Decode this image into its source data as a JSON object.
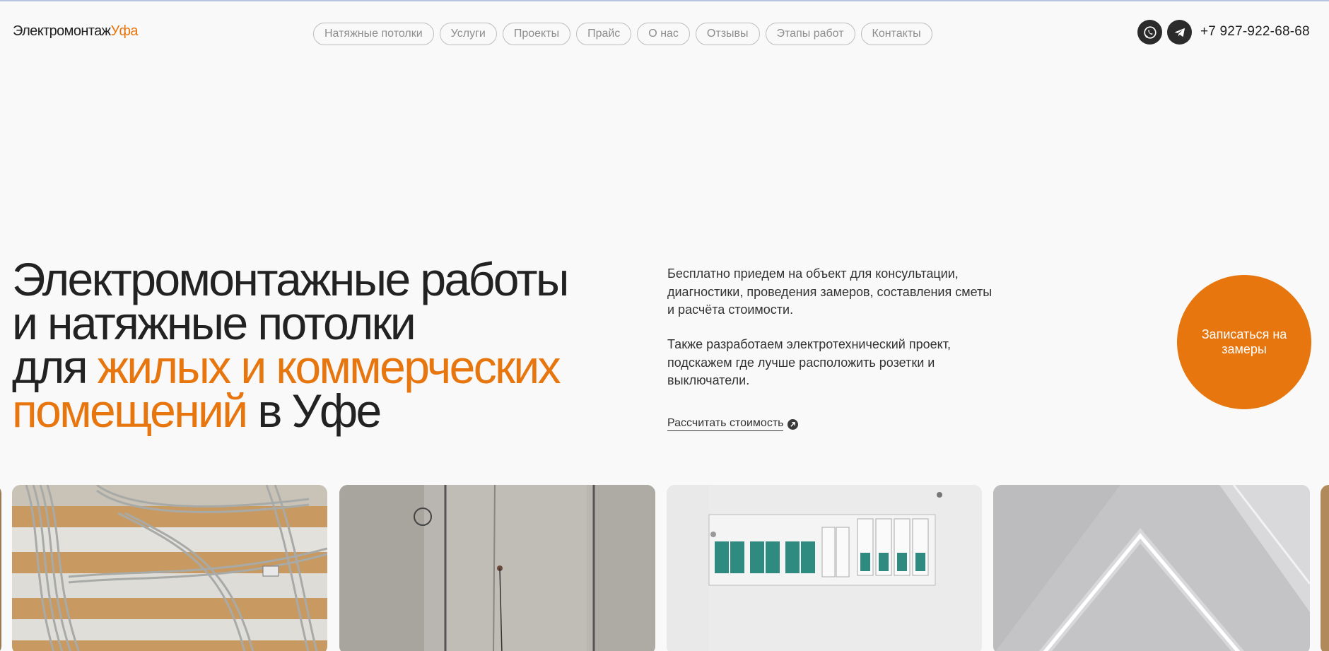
{
  "header": {
    "logo_main": "Электромонтаж",
    "logo_accent": "Уфа",
    "nav": [
      {
        "label": "Натяжные потолки"
      },
      {
        "label": "Услуги"
      },
      {
        "label": "Проекты"
      },
      {
        "label": "Прайс"
      },
      {
        "label": "О нас"
      },
      {
        "label": "Отзывы"
      },
      {
        "label": "Этапы работ"
      },
      {
        "label": "Контакты"
      }
    ],
    "social_icons": [
      "whatsapp-icon",
      "telegram-icon"
    ],
    "phone": "+7 927-922-68-68"
  },
  "hero": {
    "title_line1": "Электромонтажные работы",
    "title_line2": "и натяжные потолки",
    "title_line3_prefix": "для ",
    "title_line3_accent": "жилых и коммерческих",
    "title_line4_accent": "помещений",
    "title_line4_suffix": " в Уфе",
    "desc_p1": "Бесплатно приедем на объект для консультации, диагностики, проведения замеров, составления сметы и расчёта стоимости.",
    "desc_p2": "Также разработаем электротехнический проект, подскажем где лучше расположить розетки и выключатели.",
    "calc_link": "Рассчитать стоимость",
    "cta_label": "Записаться на замеры"
  },
  "gallery": {
    "items": [
      "ceiling-wiring-photo",
      "concrete-wall-photo",
      "electrical-panel-photo",
      "led-ceiling-photo"
    ]
  },
  "colors": {
    "accent": "#e8760f",
    "background": "#f9f9f9",
    "text": "#222222"
  }
}
